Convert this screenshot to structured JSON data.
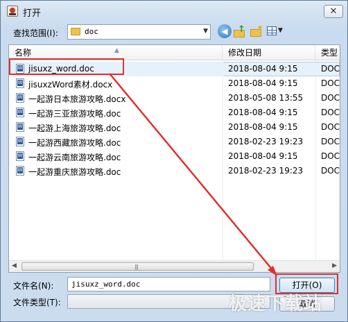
{
  "window": {
    "title": "打开",
    "close_glyph": "✕"
  },
  "location": {
    "label": "查找范围(I):",
    "value": "doc"
  },
  "toolbar": {
    "icons": [
      "back-icon",
      "up-folder-icon",
      "new-folder-icon",
      "view-menu-icon"
    ]
  },
  "filelist": {
    "columns": {
      "name": "名称",
      "date": "修改日期",
      "type": "类型"
    },
    "rows": [
      {
        "name": "jisuxz_word.doc",
        "date": "2018-08-04 9:15",
        "type": "DOC"
      },
      {
        "name": "jisuxzWord素材.docx",
        "date": "2018-08-04 9:15",
        "type": "DOC"
      },
      {
        "name": "一起游日本旅游攻略.docx",
        "date": "2018-05-08 13:55",
        "type": "DOC"
      },
      {
        "name": "一起游三亚旅游攻略.doc",
        "date": "2018-08-04 9:15",
        "type": "DOC"
      },
      {
        "name": "一起游上海旅游攻略.doc",
        "date": "2018-08-04 9:15",
        "type": "DOC"
      },
      {
        "name": "一起游西藏旅游攻略.doc",
        "date": "2018-02-23 19:23",
        "type": "DOC"
      },
      {
        "name": "一起游云南旅游攻略.doc",
        "date": "2018-08-04 9:15",
        "type": "DOC"
      },
      {
        "name": "一起游重庆旅游攻略.doc",
        "date": "2018-02-23 19:23",
        "type": "DOC"
      }
    ]
  },
  "filename": {
    "label": "文件名(N):",
    "value": "jisuxz_word.doc"
  },
  "filetype": {
    "label": "文件类型(T):",
    "value": ""
  },
  "buttons": {
    "open": "打开(O)",
    "cancel": "取消"
  },
  "watermark": "极速下载站",
  "colors": {
    "annotation": "#e0302a",
    "selection": "#e5f1fb"
  }
}
